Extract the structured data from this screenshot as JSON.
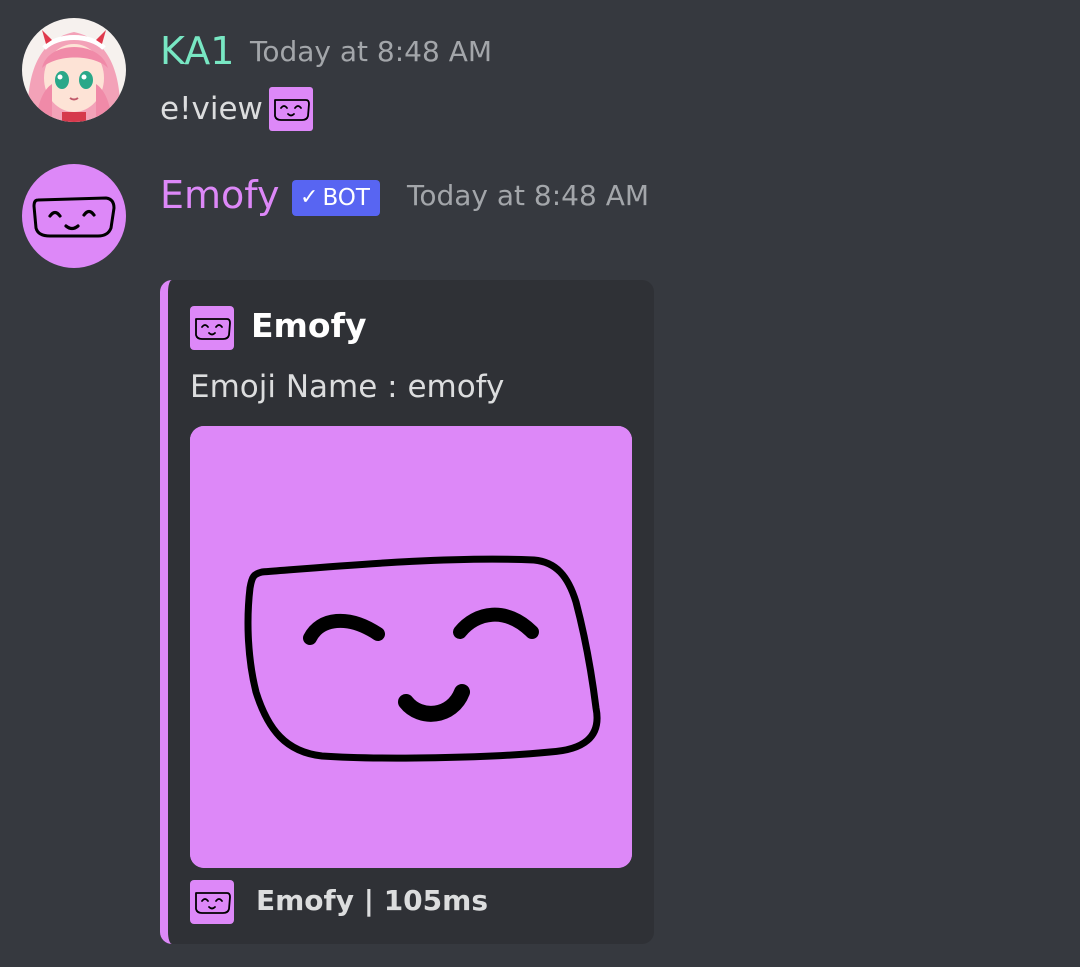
{
  "messages": [
    {
      "author": "KA1",
      "author_color": "#78e7c3",
      "timestamp": "Today at 8:48 AM",
      "text": "e!view",
      "avatar_icon": "anime-girl-avatar",
      "inline_emoji": "emofy-emoji"
    },
    {
      "author": "Emofy",
      "author_color": "#dd88f8",
      "bot_tag": "BOT",
      "bot_check": "✓",
      "timestamp": "Today at 8:48 AM",
      "avatar_icon": "emofy-face-avatar"
    }
  ],
  "embed": {
    "accent_color": "#dd88f8",
    "author_name": "Emofy",
    "description": "Emoji Name : emofy",
    "image_icon": "emofy-face-icon",
    "footer": "Emofy | 105ms"
  },
  "colors": {
    "background": "#36393f",
    "embed_background": "#2f3136",
    "bot_tag": "#5865f2",
    "emoji_purple": "#dd88f8"
  }
}
